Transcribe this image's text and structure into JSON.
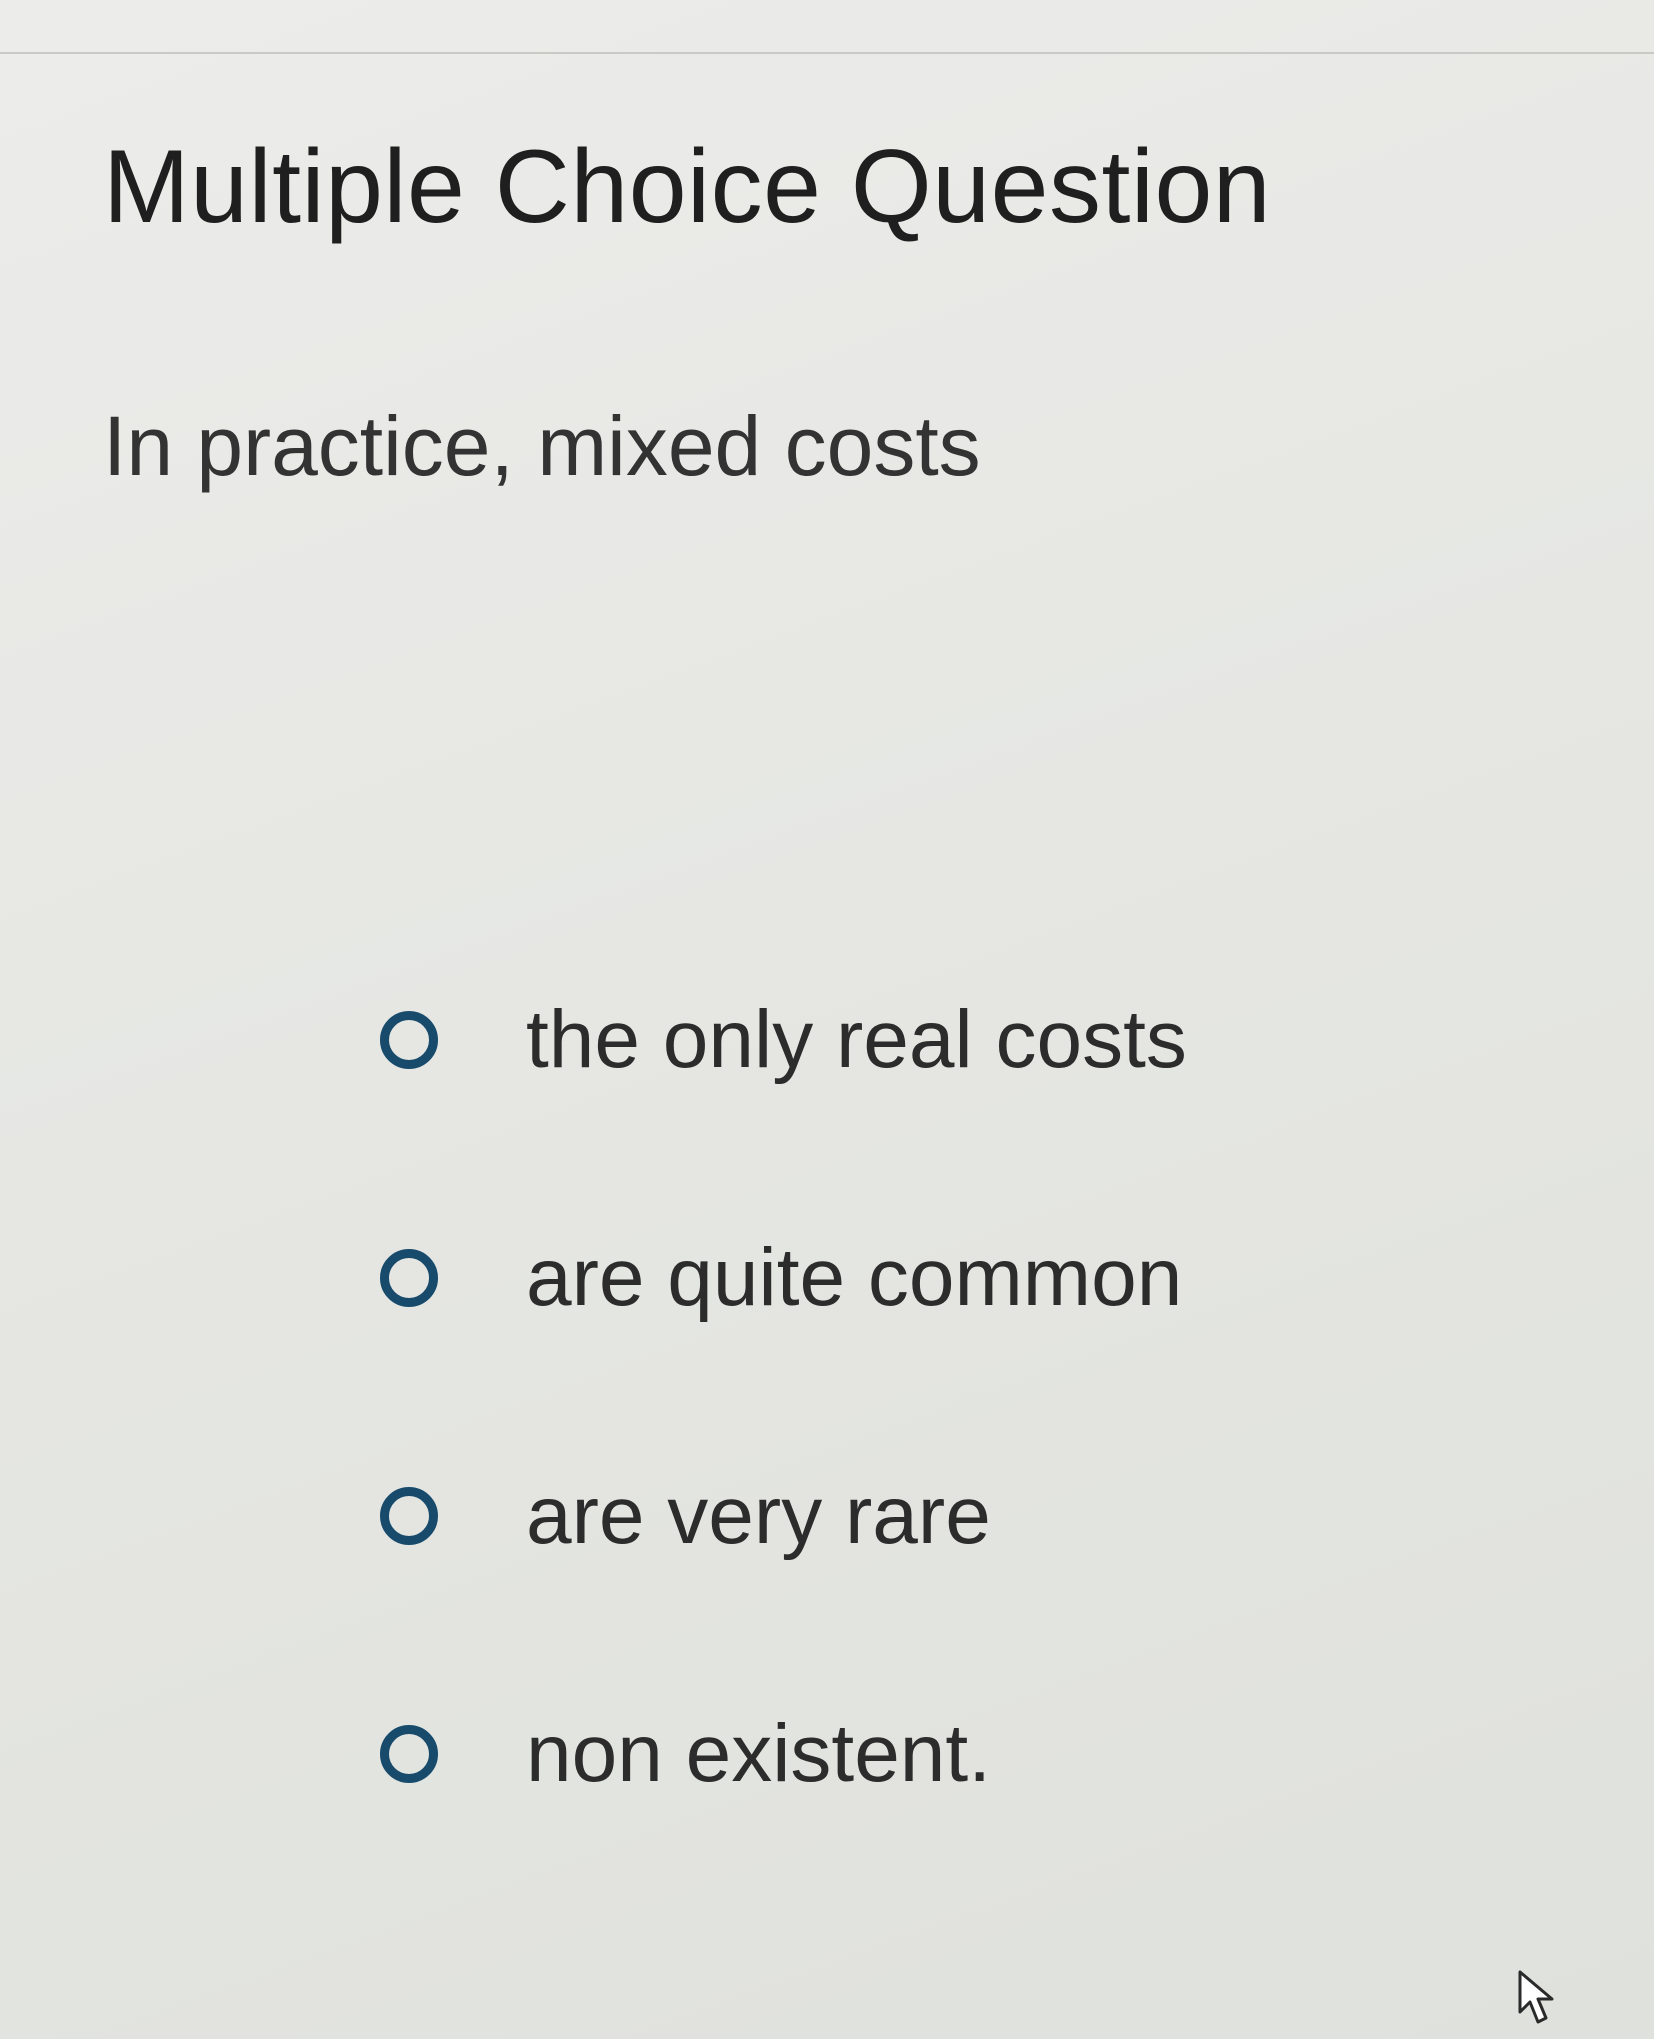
{
  "page": {
    "title": "Multiple Choice Question",
    "question": "In practice, mixed costs"
  },
  "choices": [
    {
      "label": "the only real costs",
      "selected": false
    },
    {
      "label": "are quite common",
      "selected": false
    },
    {
      "label": "are very rare",
      "selected": false
    },
    {
      "label": "non existent.",
      "selected": false
    }
  ],
  "icons": {
    "radio": "radio-unselected-icon",
    "cursor": "mouse-pointer-icon"
  },
  "colors": {
    "radio_border": "#174a6b",
    "text": "#2c2c2c",
    "background": "#e6e7e3"
  }
}
